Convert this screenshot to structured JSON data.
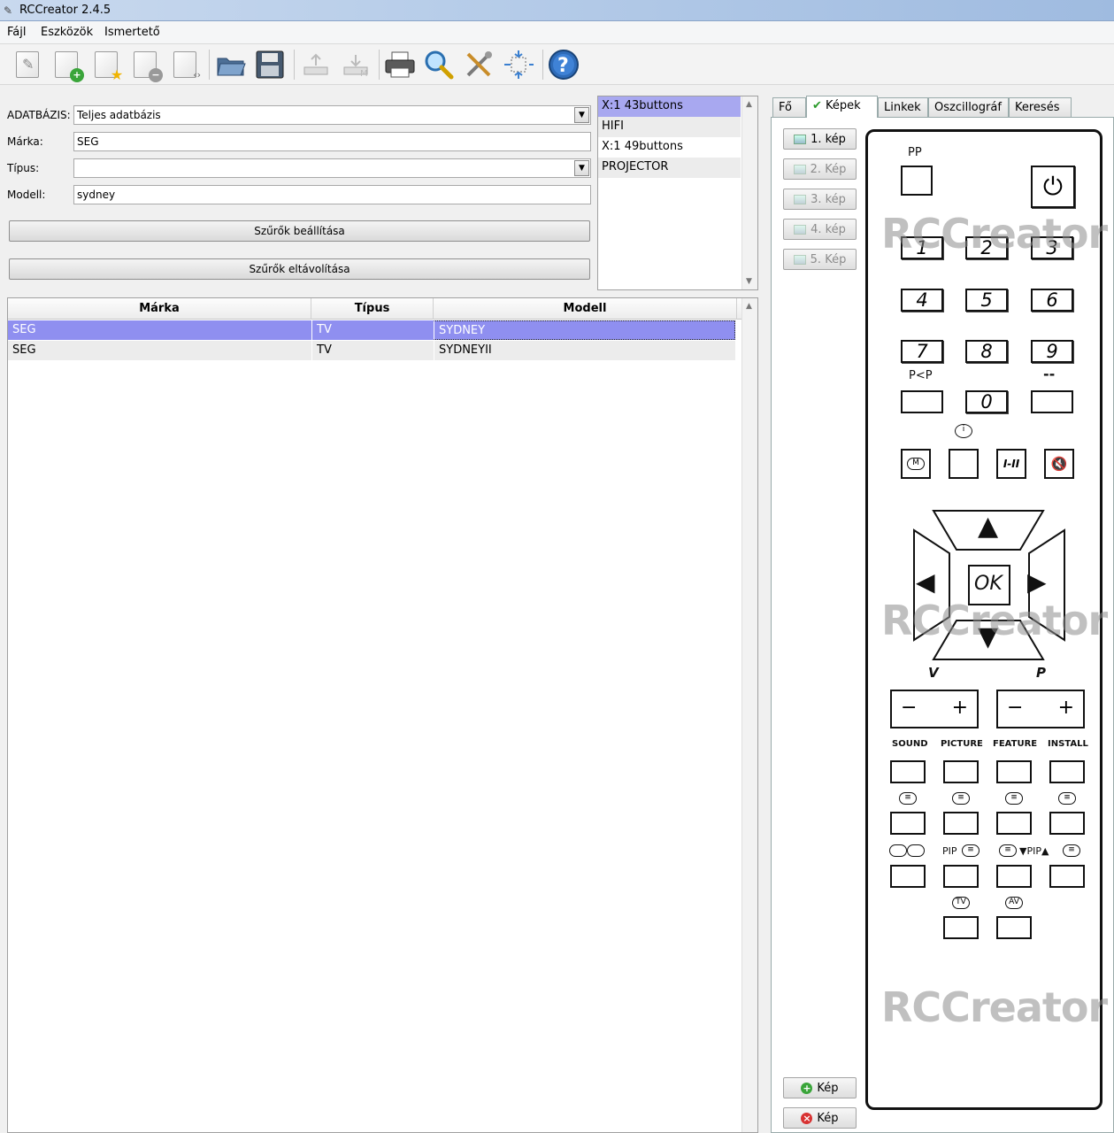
{
  "window": {
    "title": "RCCreator 2.4.5"
  },
  "menu": [
    "Fájl",
    "Eszközök",
    "Ismertető"
  ],
  "toolbar": {
    "icons": [
      "new-document-icon",
      "add-document-icon",
      "favorite-document-icon",
      "remove-document-icon",
      "export-document-icon",
      "open-folder-icon",
      "save-disk-icon",
      "upload-icon",
      "download-icon",
      "printer-icon",
      "search-icon",
      "tools-icon",
      "fit-view-icon",
      "help-icon"
    ]
  },
  "filters": {
    "database_label": "ADATBÁZIS:",
    "database_value": "Teljes adatbázis",
    "brand_label": "Márka:",
    "brand_value": "SEG",
    "type_label": "Típus:",
    "type_value": "",
    "model_label": "Modell:",
    "model_value": "sydney",
    "apply_button": "Szűrők beállítása",
    "clear_button": "Szűrők eltávolítása"
  },
  "layout_list": [
    "X:1 43buttons",
    "HIFI",
    "X:1 49buttons",
    "PROJECTOR"
  ],
  "results": {
    "headers": [
      "Márka",
      "Típus",
      "Modell"
    ],
    "rows": [
      [
        "SEG",
        "TV",
        "SYDNEY"
      ],
      [
        "SEG",
        "TV",
        "SYDNEYII"
      ]
    ]
  },
  "tabs": [
    "Fő",
    "Képek",
    "Linkek",
    "Oszcillográf",
    "Keresés"
  ],
  "pictures": {
    "buttons": [
      "1. kép",
      "2. Kép",
      "3. kép",
      "4. kép",
      "5. Kép"
    ],
    "add_label": "Kép",
    "delete_label": "Kép"
  },
  "remote": {
    "pp": "PP",
    "digits": [
      "1",
      "2",
      "3",
      "4",
      "5",
      "6",
      "7",
      "8",
      "9",
      "0"
    ],
    "ppp": "P<P",
    "dash": "--",
    "info": "i",
    "menu": "M",
    "dual": "I-II",
    "mute": "🔇",
    "ok": "OK",
    "up": "▲",
    "down": "▼",
    "left": "◀",
    "right": "▶",
    "v": "V",
    "p": "P",
    "minus": "−",
    "plus": "+",
    "row_labels": [
      "SOUND",
      "PICTURE",
      "FEATURE",
      "INSTALL"
    ],
    "pip_left": "PIP",
    "pip_right": "▼PIP▲",
    "tv": "TV",
    "av": "AV",
    "power": "⏻",
    "watermark": "RCCreator"
  }
}
